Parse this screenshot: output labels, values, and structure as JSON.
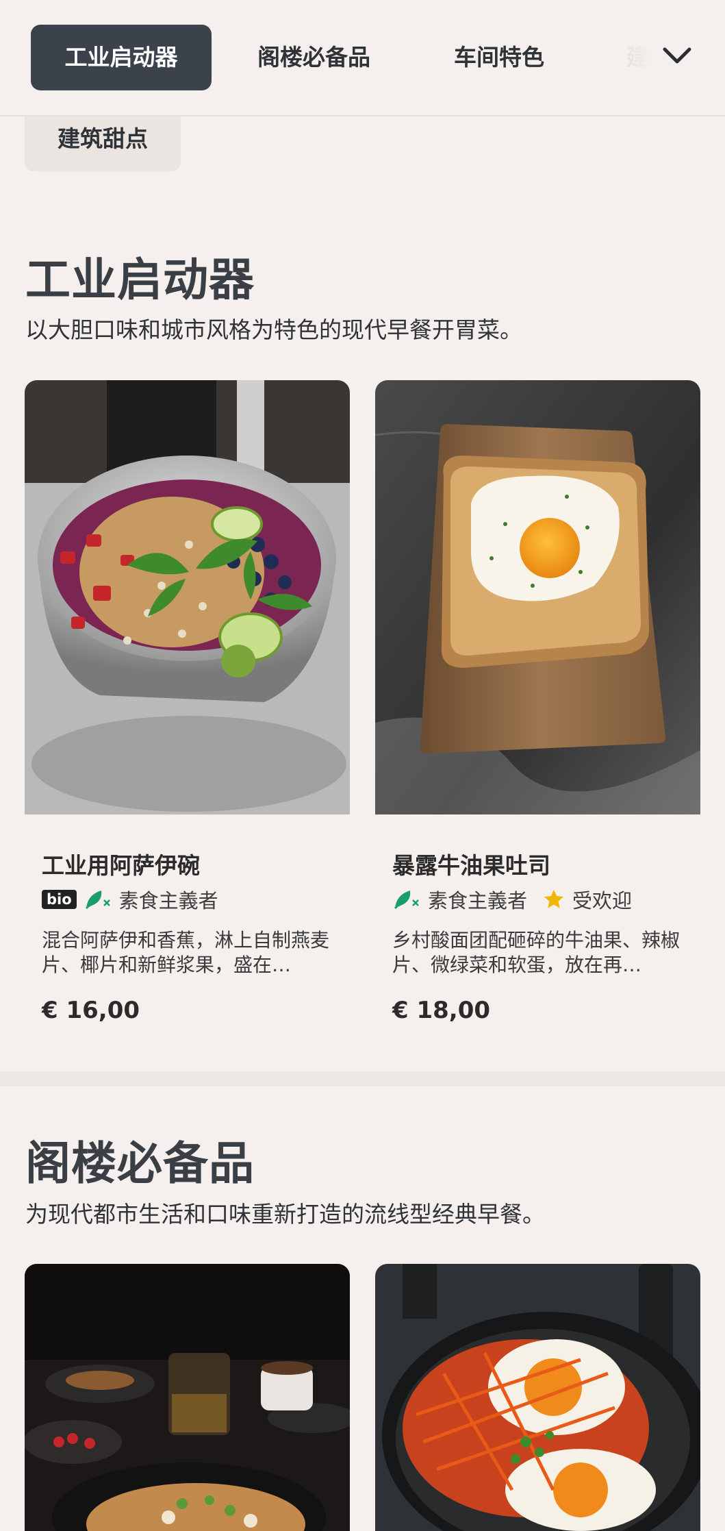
{
  "nav": {
    "tabs": [
      {
        "label": "工业启动器",
        "active": true
      },
      {
        "label": "阁楼必备品",
        "active": false
      },
      {
        "label": "车间特色",
        "active": false
      },
      {
        "label": "建",
        "active": false
      }
    ],
    "overflow_tab": "建筑甜点",
    "expand_icon": "chevron-down-icon"
  },
  "sections": [
    {
      "title": "工业启动器",
      "description": "以大胆口味和城市风格为特色的现代早餐开胃菜。",
      "items": [
        {
          "name": "工业用阿萨伊碗",
          "badges": [
            "bio"
          ],
          "diet_label": "素食主義者",
          "diet_icon": "vegetarian-leaf-icon",
          "description": "混合阿萨伊和香蕉，淋上自制燕麦片、椰片和新鲜浆果，盛在…",
          "price": "€ 16,00"
        },
        {
          "name": "暴露牛油果吐司",
          "badges": [],
          "diet_label": "素食主義者",
          "diet_icon": "vegetarian-leaf-icon",
          "popular_label": "受欢迎",
          "popular_icon": "star-icon",
          "description": "乡村酸面团配砸碎的牛油果、辣椒片、微绿菜和软蛋，放在再…",
          "price": "€ 18,00"
        }
      ]
    },
    {
      "title": "阁楼必备品",
      "description": "为现代都市生活和口味重新打造的流线型经典早餐。"
    }
  ],
  "colors": {
    "background": "#f5f0ed",
    "active_tab": "#3b424b",
    "heading": "#3a3f45",
    "vegetarian_green": "#1a9e6a",
    "star_yellow": "#f2b600"
  }
}
